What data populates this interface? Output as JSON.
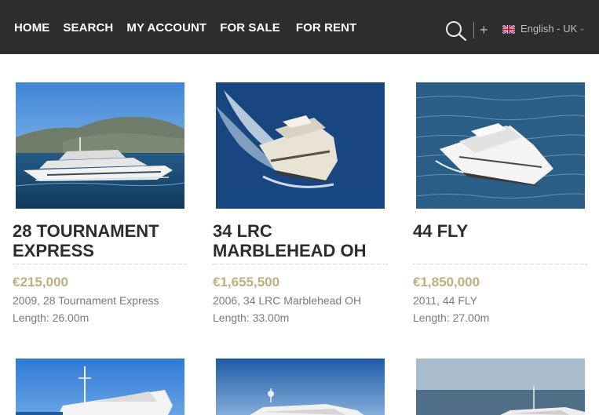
{
  "nav": {
    "items": [
      {
        "label": "HOME"
      },
      {
        "label": "SEARCH"
      },
      {
        "label": "MY ACCOUNT"
      },
      {
        "label": "FOR SALE"
      },
      {
        "label": "FOR RENT"
      }
    ]
  },
  "header": {
    "search_icon": "search-icon",
    "plus_icon": "+",
    "language": "English - UK",
    "chevron": "⌄"
  },
  "listings": [
    {
      "title": "28 TOURNAMENT EXPRESS",
      "price": "€215,000",
      "desc": "2009, 28 Tournament Express",
      "length": "Length: 26.00m"
    },
    {
      "title": "34 LRC MARBLEHEAD OH",
      "price": "€1,655,500",
      "desc": "2006, 34 LRC Marblehead OH",
      "length": "Length: 33.00m"
    },
    {
      "title": "44 FLY",
      "price": "€1,850,000",
      "desc": "2011, 44 FLY",
      "length": "Length: 27.00m"
    }
  ],
  "colors": {
    "topbar": "#2d2d2d",
    "price": "#bfae7e",
    "title": "#2d2d2d"
  }
}
